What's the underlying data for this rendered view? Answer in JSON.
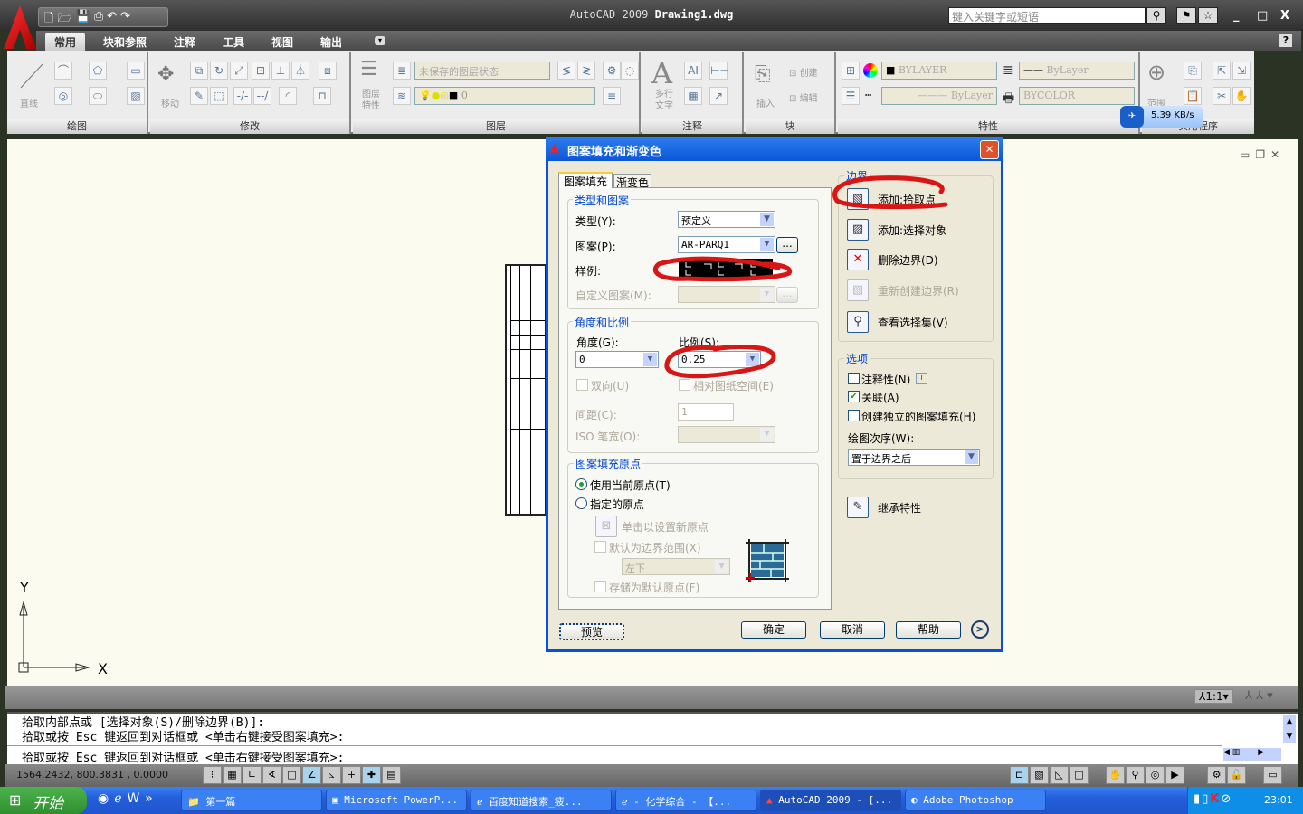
{
  "app": {
    "title_prefix": "AutoCAD  2009",
    "title_file": "Drawing1.dwg",
    "search_placeholder": "键入关键字或短语"
  },
  "tabs": [
    {
      "label": "常用",
      "active": true
    },
    {
      "label": "块和参照"
    },
    {
      "label": "注释"
    },
    {
      "label": "工具"
    },
    {
      "label": "视图"
    },
    {
      "label": "输出"
    }
  ],
  "ribbon": {
    "panels": [
      "绘图",
      "修改",
      "图层",
      "注释",
      "块",
      "特性",
      "实用程序"
    ],
    "line_label": "直线",
    "move_label": "移动",
    "layer_props_label": "图层\n特性",
    "mtext_label": "多行\n文字",
    "insert_label": "插入",
    "create_label": "创建",
    "edit_label": "编辑",
    "range_label": "范围",
    "layer_state": "未保存的图层状态",
    "layer_current": "0",
    "color": "BYLAYER",
    "lineweight": "ByLayer",
    "linetype": "ByLayer",
    "plotstyle": "BYCOLOR",
    "net_speed": "5.39 KB/s"
  },
  "dialog": {
    "title": "图案填充和渐变色",
    "tabs": [
      "图案填充",
      "渐变色"
    ],
    "type_group": "类型和图案",
    "type_label": "类型(Y):",
    "type_value": "预定义",
    "pattern_label": "图案(P):",
    "pattern_value": "AR-PARQ1",
    "browse": "...",
    "sample_label": "样例:",
    "custom_label": "自定义图案(M):",
    "angle_group": "角度和比例",
    "angle_label": "角度(G):",
    "angle_value": "0",
    "scale_label": "比例(S):",
    "scale_value": "0.25",
    "double_label": "双向(U)",
    "relative_label": "相对图纸空间(E)",
    "spacing_label": "间距(C):",
    "spacing_value": "1",
    "iso_label": "ISO 笔宽(O):",
    "origin_group": "图案填充原点",
    "use_current": "使用当前原点(T)",
    "specified": "指定的原点",
    "click_set": "单击以设置新原点",
    "default_extent": "默认为边界范围(X)",
    "extent_value": "左下",
    "store_default": "存储为默认原点(F)",
    "boundary_group": "边界",
    "add_pick": "添加:拾取点",
    "add_select": "添加:选择对象",
    "remove": "删除边界(D)",
    "recreate": "重新创建边界(R)",
    "view_sel": "查看选择集(V)",
    "options_group": "选项",
    "annotative": "注释性(N)",
    "associative": "关联(A)",
    "separate": "创建独立的图案填充(H)",
    "draw_order_label": "绘图次序(W):",
    "draw_order_value": "置于边界之后",
    "inherit": "继承特性",
    "preview": "预览",
    "ok": "确定",
    "cancel": "取消",
    "help": "帮助",
    "annotation_color": "#d91616"
  },
  "canvas": {
    "ucs_y": "Y",
    "ucs_x": "X"
  },
  "layout": {
    "scale": "1:1"
  },
  "command": {
    "lines": [
      "拾取内部点或 [选择对象(S)/删除边界(B)]:",
      "拾取或按 Esc 键返回到对话框或 <单击右键接受图案填充>:"
    ],
    "prompt": "拾取或按 Esc 键返回到对话框或 <单击右键接受图案填充>:"
  },
  "status": {
    "coords": "1564.2432, 800.3831 , 0.0000"
  },
  "taskbar": {
    "start": "开始",
    "items": [
      "第一篇",
      "Microsoft PowerP...",
      "百度知道搜索_疲...",
      "- 化学综合 - 【...",
      "AutoCAD 2009 - [...",
      "Adobe Photoshop"
    ],
    "clock": "23:01"
  }
}
